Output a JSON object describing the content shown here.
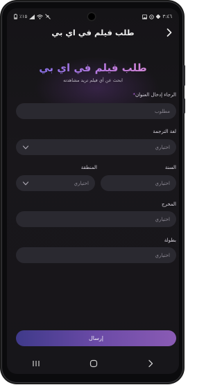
{
  "status": {
    "time": "٣:٤٦",
    "battery": "٪١٥",
    "left_icons": [
      "battery-icon",
      "signal-icon",
      "wifi-icon",
      "mute-icon"
    ],
    "right_icons": [
      "gallery-icon",
      "settings-icon",
      "notification-dot-icon"
    ]
  },
  "header": {
    "title": "طلب فيلم في اي بي"
  },
  "hero": {
    "title": "طلب فيلم في اي بي",
    "subtitle": "ابحث عن أي فيلم تريد مشاهدته"
  },
  "form": {
    "title_label": "الرجاء إدخال العنوان",
    "required_mark": "*",
    "title_placeholder": "مطلوب",
    "translation_label": "لغة الترجمة",
    "translation_value": "اختياري",
    "year_label": "السنة",
    "year_placeholder": "اختياري",
    "region_label": "المنطقة",
    "region_value": "اختياري",
    "director_label": "المخرج",
    "director_placeholder": "اختياري",
    "starring_label": "بطولة",
    "starring_placeholder": "اختياري",
    "submit_label": "إرسال"
  },
  "colors": {
    "accent_start": "#3f3a8a",
    "accent_end": "#8a5bb4",
    "title_gradient_start": "#6f6be8",
    "title_gradient_end": "#e08fd0",
    "field_bg": "#2a2930",
    "background": "#17161a"
  },
  "navbar": {
    "icons": [
      "recent-apps-icon",
      "home-icon",
      "back-nav-icon"
    ]
  }
}
